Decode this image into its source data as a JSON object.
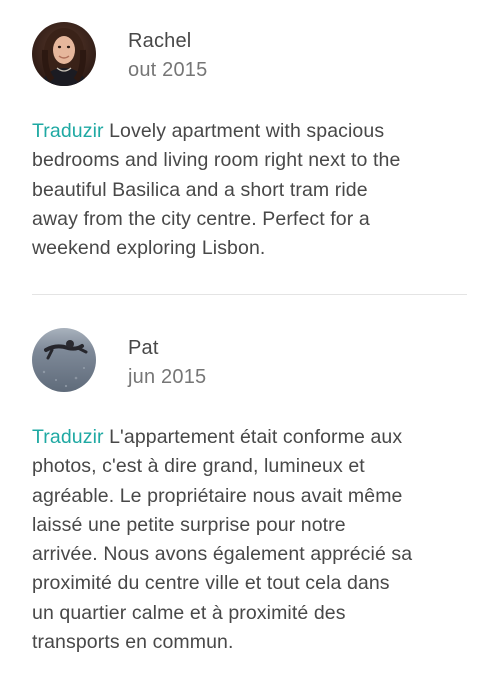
{
  "reviews": [
    {
      "author": "Rachel",
      "date": "out 2015",
      "translate_label": "Traduzir",
      "text": " Lovely apartment with spacious\nbedrooms and living room right next to the\nbeautiful Basilica and a short tram ride\naway from the city centre. Perfect for a\nweekend exploring Lisbon."
    },
    {
      "author": "Pat",
      "date": "jun 2015",
      "translate_label": "Traduzir",
      "text": " L'appartement était conforme aux\nphotos, c'est à dire grand, lumineux et\nagréable. Le propriétaire nous avait même\nlaissé une petite surprise pour notre\narrivée. Nous avons également apprécié sa\nproximité du centre ville et tout cela dans\nun quartier calme et à proximité des\ntransports en commun."
    }
  ],
  "colors": {
    "link": "#1fa9a3",
    "text": "#484848",
    "muted": "#767676",
    "divider": "#e4e4e4"
  },
  "icons": {
    "avatar_1": "user-photo-avatar",
    "avatar_2": "user-photo-avatar"
  }
}
